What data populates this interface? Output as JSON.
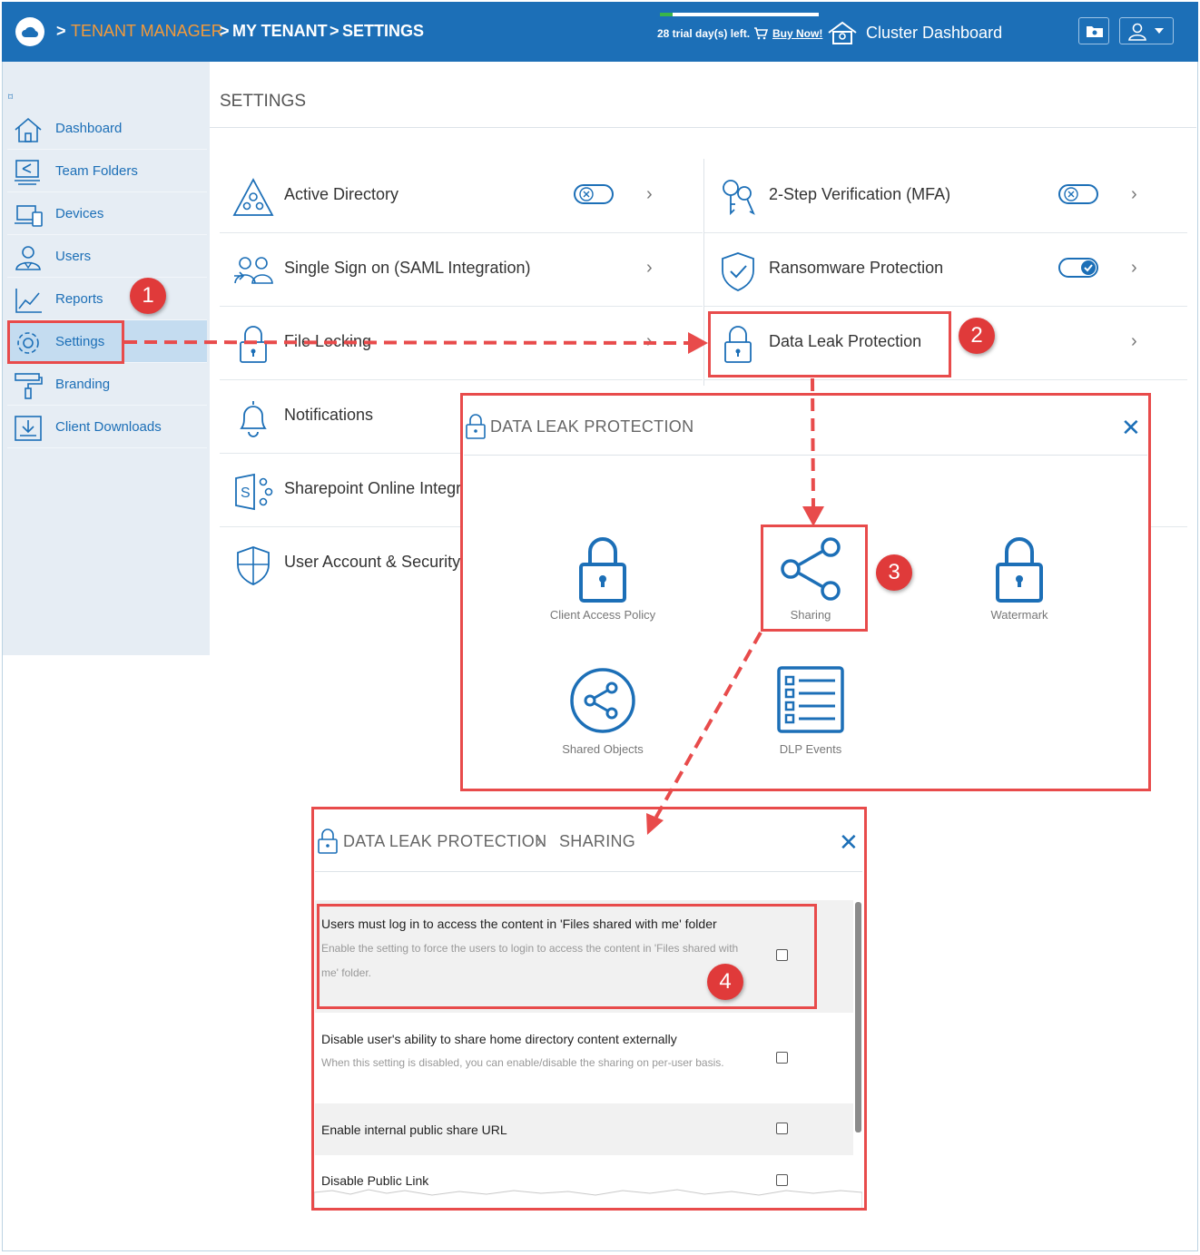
{
  "header": {
    "crumb_sep1": ">",
    "crumb_tenant_manager": "TENANT MANAGER",
    "crumb_sep2": ">",
    "crumb_my_tenant": "MY TENANT",
    "crumb_sep3": ">",
    "crumb_settings": "SETTINGS",
    "trial_text": "28 trial day(s) left.",
    "buy_now": "Buy Now!",
    "cluster_dashboard": "Cluster Dashboard",
    "trial_progress": 0.08
  },
  "sidebar": {
    "menu_glyph": "⌑",
    "items": [
      {
        "label": "Dashboard",
        "icon": "home-icon"
      },
      {
        "label": "Team Folders",
        "icon": "team-folders-icon"
      },
      {
        "label": "Devices",
        "icon": "devices-icon"
      },
      {
        "label": "Users",
        "icon": "users-icon"
      },
      {
        "label": "Reports",
        "icon": "reports-icon"
      },
      {
        "label": "Settings",
        "icon": "gear-icon",
        "active": true
      },
      {
        "label": "Branding",
        "icon": "paint-roller-icon"
      },
      {
        "label": "Client Downloads",
        "icon": "download-icon"
      }
    ]
  },
  "main": {
    "title": "SETTINGS",
    "left_rows": [
      {
        "label": "Active Directory",
        "toggle": "off"
      },
      {
        "label": "Single Sign on (SAML Integration)"
      },
      {
        "label": "File Locking"
      },
      {
        "label": "Notifications"
      },
      {
        "label": "Sharepoint Online Integra"
      },
      {
        "label": "User Account & Security"
      }
    ],
    "right_rows": [
      {
        "label": "2-Step Verification (MFA)",
        "toggle": "off"
      },
      {
        "label": "Ransomware Protection",
        "toggle": "on"
      },
      {
        "label": "Data Leak Protection"
      }
    ],
    "chevron": "›"
  },
  "annotations": {
    "badge1": "1",
    "badge2": "2",
    "badge3": "3",
    "badge4": "4"
  },
  "dlp_dialog": {
    "title": "DATA LEAK PROTECTION",
    "close": "✕",
    "tiles": [
      {
        "label": "Client Access Policy",
        "icon": "lock-icon"
      },
      {
        "label": "Sharing",
        "icon": "share-icon"
      },
      {
        "label": "Watermark",
        "icon": "lock-icon"
      },
      {
        "label": "Shared Objects",
        "icon": "shared-objects-icon"
      },
      {
        "label": "DLP Events",
        "icon": "list-icon"
      }
    ]
  },
  "sharing_dialog": {
    "title": "DATA LEAK PROTECTION",
    "sep": "›",
    "subtitle": "SHARING",
    "close": "✕",
    "settings": [
      {
        "title": "Users must log in to access the content in 'Files shared with me' folder",
        "desc": "Enable the setting to force the users to login to access the content in 'Files shared with me' folder.",
        "checked": false
      },
      {
        "title": "Disable user's ability to share home directory content externally",
        "desc": "When this setting is disabled, you can enable/disable the sharing on per-user basis.",
        "checked": false
      },
      {
        "title": "Enable internal public share URL",
        "desc": "",
        "checked": false
      },
      {
        "title": "Disable Public Link",
        "desc": "",
        "checked": false
      }
    ]
  },
  "colors": {
    "brand_blue": "#1c6fb7",
    "accent_orange": "#f39a3a",
    "annotation_red": "#e84b4b"
  }
}
